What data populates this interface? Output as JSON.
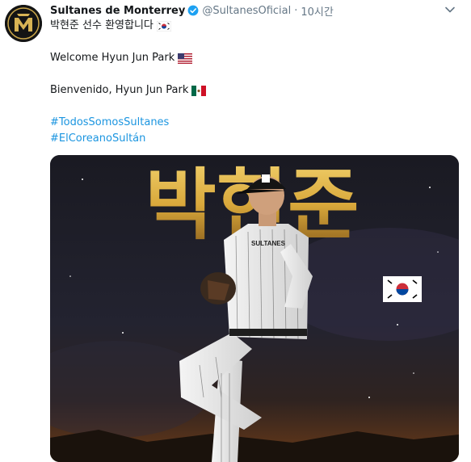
{
  "tweet": {
    "display_name": "Sultanes de Monterrey",
    "handle": "@SultanesOficial",
    "separator": "·",
    "time": "10시간",
    "lines": {
      "korean": "박현준 선수 환영합니다",
      "english": "Welcome Hyun Jun Park",
      "spanish": "Bienvenido, Hyun Jun Park"
    },
    "flag_icons": {
      "korean": "south-korea-flag-icon",
      "english": "united-states-flag-icon",
      "spanish": "mexico-flag-icon"
    },
    "hashtags": [
      "#TodosSomosSultanes",
      "#ElCoreanoSultán"
    ]
  },
  "media": {
    "poster_title": "박현준",
    "jersey_text": "SULTANES"
  },
  "colors": {
    "hashtag": "#1b95e0",
    "verified": "#1da1f2",
    "meta": "#657786",
    "poster_gold": "#d9a83b",
    "poster_bg": "#15151c"
  }
}
